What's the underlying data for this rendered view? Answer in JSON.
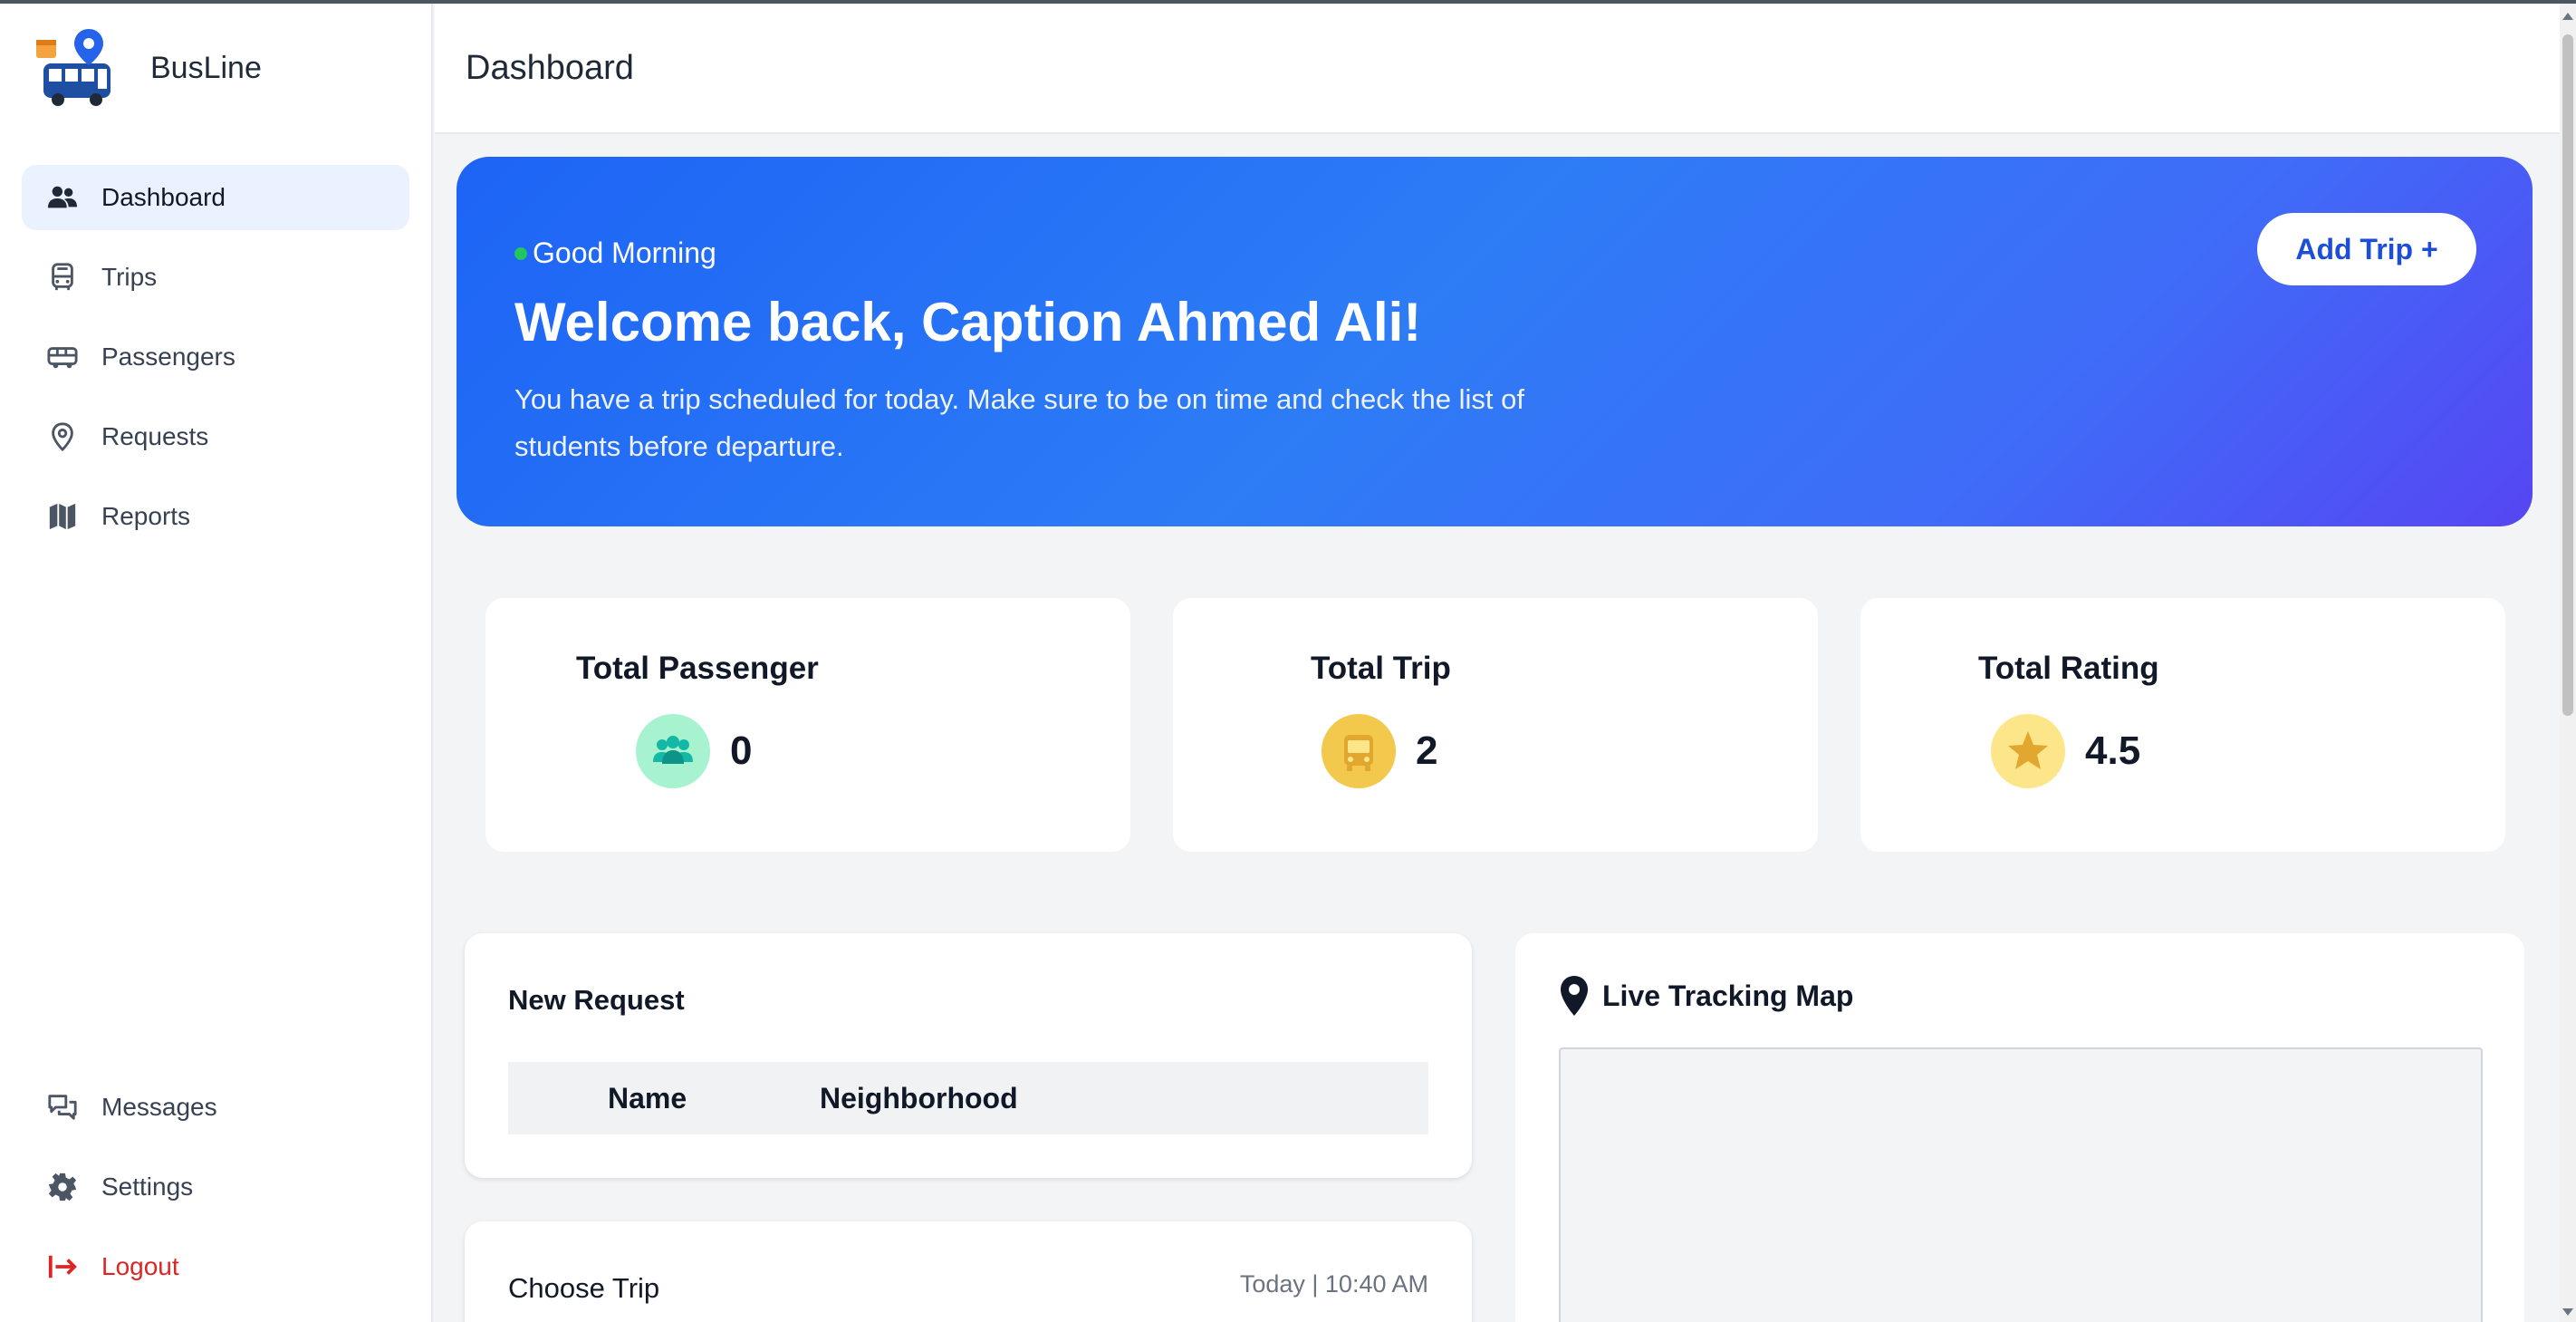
{
  "app": {
    "name": "BusLine"
  },
  "sidebar": {
    "items": [
      {
        "label": "Dashboard",
        "icon": "users-icon"
      },
      {
        "label": "Trips",
        "icon": "bus-icon"
      },
      {
        "label": "Passengers",
        "icon": "bus-side-icon"
      },
      {
        "label": "Requests",
        "icon": "map-pin-icon"
      },
      {
        "label": "Reports",
        "icon": "map-folded-icon"
      }
    ],
    "bottom": [
      {
        "label": "Messages",
        "icon": "chat-icon"
      },
      {
        "label": "Settings",
        "icon": "gear-icon"
      },
      {
        "label": "Logout",
        "icon": "logout-icon"
      }
    ]
  },
  "header": {
    "title": "Dashboard"
  },
  "banner": {
    "greeting": "Good Morning",
    "welcome": "Welcome back, Caption Ahmed Ali!",
    "description": "You have a trip scheduled for today. Make sure to be on time and check the list of students before departure.",
    "button": "Add Trip +"
  },
  "stats": [
    {
      "title": "Total Passenger",
      "value": "0",
      "icon": "group-icon",
      "color": "#a7f3d0"
    },
    {
      "title": "Total Trip",
      "value": "2",
      "icon": "bus-icon",
      "color": "#f2c94c"
    },
    {
      "title": "Total Rating",
      "value": "4.5",
      "icon": "star-icon",
      "color": "#fde68a"
    }
  ],
  "requests": {
    "title": "New Request",
    "columns": [
      "Name",
      "Neighborhood"
    ]
  },
  "choose_trip": {
    "title": "Choose Trip",
    "time": "Today | 10:40 AM"
  },
  "map": {
    "title": "Live Tracking Map"
  },
  "colors": {
    "accent": "#2563eb",
    "danger": "#dc2626",
    "success": "#22c55e"
  }
}
